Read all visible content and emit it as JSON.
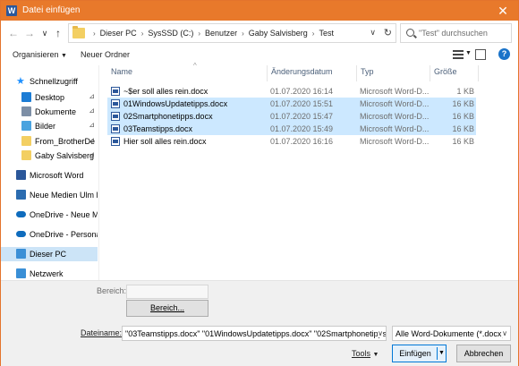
{
  "window": {
    "title": "Datei einfügen",
    "app_icon": "word-icon",
    "close_glyph": "✕"
  },
  "nav": {
    "back_glyph": "←",
    "forward_glyph": "→",
    "recent_glyph": "∨",
    "up_glyph": "↑",
    "breadcrumb": [
      "Dieser PC",
      "SysSSD (C:)",
      "Benutzer",
      "Gaby Salvisberg",
      "Test"
    ],
    "refresh_glyph": "↻",
    "search_placeholder": "\"Test\" durchsuchen"
  },
  "toolbar": {
    "organize": "Organisieren",
    "new_folder": "Neuer Ordner",
    "help": "?"
  },
  "sidebar": {
    "items": [
      {
        "label": "Schnellzugriff",
        "icon": "star-icon",
        "color": "#1e90ff",
        "pinned": false,
        "selected": false
      },
      {
        "label": "Desktop",
        "icon": "desktop-folder-icon",
        "color": "#1c7cd5",
        "pinned": true,
        "selected": false
      },
      {
        "label": "Dokumente",
        "icon": "documents-folder-icon",
        "color": "#7d8fa6",
        "pinned": true,
        "selected": false
      },
      {
        "label": "Bilder",
        "icon": "pictures-folder-icon",
        "color": "#4aa3df",
        "pinned": true,
        "selected": false
      },
      {
        "label": "From_BrotherDe",
        "icon": "folder-icon",
        "color": "#f3cf62",
        "pinned": true,
        "selected": false
      },
      {
        "label": "Gaby Salvisberg",
        "icon": "folder-icon",
        "color": "#f3cf62",
        "pinned": true,
        "selected": false
      },
      {
        "label": "Microsoft Word",
        "icon": "word-icon",
        "color": "#2b579a",
        "pinned": false,
        "selected": false
      },
      {
        "label": "Neue Medien Ulm Ho",
        "icon": "building-icon",
        "color": "#2b6cb0",
        "pinned": false,
        "selected": false
      },
      {
        "label": "OneDrive - Neue Med",
        "icon": "onedrive-icon",
        "color": "#0f6cbd",
        "pinned": false,
        "selected": false
      },
      {
        "label": "OneDrive - Personal",
        "icon": "onedrive-icon",
        "color": "#0f6cbd",
        "pinned": false,
        "selected": false
      },
      {
        "label": "Dieser PC",
        "icon": "pc-icon",
        "color": "#3a8fd6",
        "pinned": false,
        "selected": true
      },
      {
        "label": "Netzwerk",
        "icon": "network-icon",
        "color": "#3a8fd6",
        "pinned": false,
        "selected": false
      }
    ],
    "pin_glyph": "📌"
  },
  "columns": {
    "name": "Name",
    "date": "Änderungsdatum",
    "type": "Typ",
    "size": "Größe"
  },
  "files": [
    {
      "name": "~$er soll alles rein.docx",
      "date": "01.07.2020 16:14",
      "type": "Microsoft Word-D...",
      "size": "1 KB",
      "selected": false
    },
    {
      "name": "01WindowsUpdatetipps.docx",
      "date": "01.07.2020 15:51",
      "type": "Microsoft Word-D...",
      "size": "16 KB",
      "selected": true
    },
    {
      "name": "02Smartphonetipps.docx",
      "date": "01.07.2020 15:47",
      "type": "Microsoft Word-D...",
      "size": "16 KB",
      "selected": true
    },
    {
      "name": "03Teamstipps.docx",
      "date": "01.07.2020 15:49",
      "type": "Microsoft Word-D...",
      "size": "16 KB",
      "selected": true
    },
    {
      "name": "Hier soll alles rein.docx",
      "date": "01.07.2020 16:16",
      "type": "Microsoft Word-D...",
      "size": "16 KB",
      "selected": false
    }
  ],
  "bottom": {
    "range_label": "Bereich:",
    "range_button": "Bereich...",
    "filename_label": "Dateiname:",
    "filename_value": "\"03Teamstipps.docx\" \"01WindowsUpdatetipps.docx\" \"02Smartphonetipps.docx\"",
    "filetype_value": "Alle Word-Dokumente (*.docx;",
    "tools": "Tools",
    "insert": "Einfügen",
    "cancel": "Abbrechen"
  }
}
